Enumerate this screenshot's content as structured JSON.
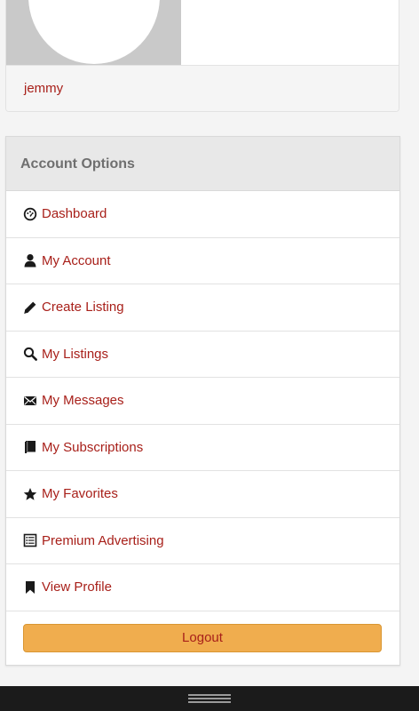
{
  "profile": {
    "username": "jemmy"
  },
  "account_options": {
    "title": "Account Options",
    "items": [
      {
        "label": "Dashboard",
        "icon": "dashboard-icon"
      },
      {
        "label": "My Account",
        "icon": "user-icon"
      },
      {
        "label": "Create Listing",
        "icon": "pencil-icon"
      },
      {
        "label": "My Listings",
        "icon": "search-icon"
      },
      {
        "label": "My Messages",
        "icon": "envelope-icon"
      },
      {
        "label": "My Subscriptions",
        "icon": "book-icon"
      },
      {
        "label": "My Favorites",
        "icon": "star-icon"
      },
      {
        "label": "Premium Advertising",
        "icon": "list-icon"
      },
      {
        "label": "View Profile",
        "icon": "bookmark-icon"
      }
    ],
    "logout_label": "Logout"
  },
  "colors": {
    "link": "#a8201a",
    "logout_button": "#f0ad4e",
    "header_bg": "#e8e8e8",
    "nav_bar": "#1b1b1b"
  }
}
